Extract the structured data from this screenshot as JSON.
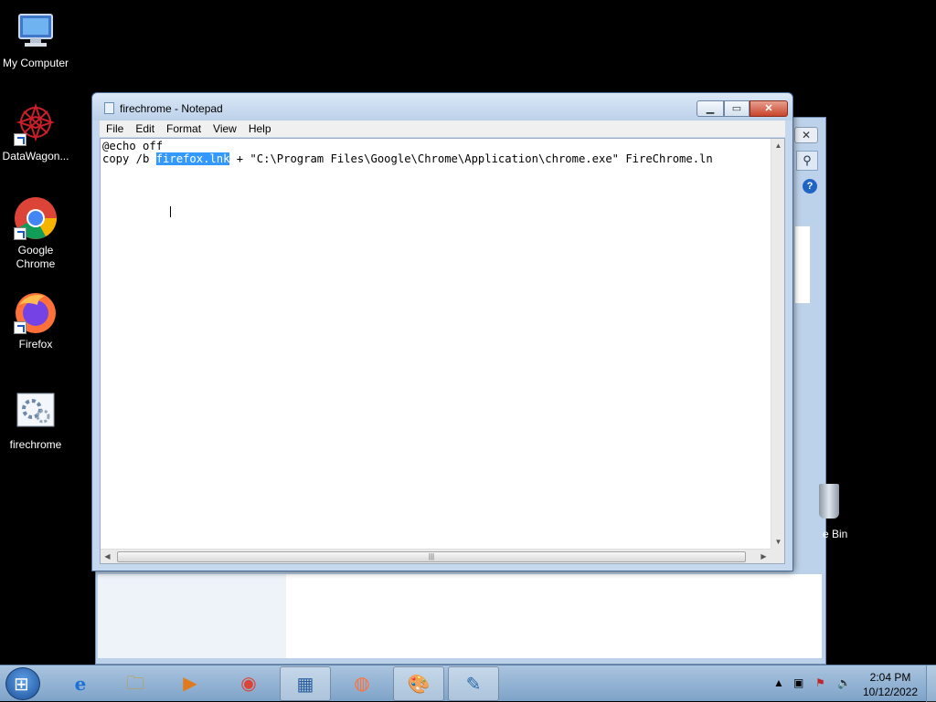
{
  "desktop_icons": [
    {
      "label": "My Computer",
      "icon": "computer-icon"
    },
    {
      "label": "DataWagon...",
      "icon": "datawagon-icon"
    },
    {
      "label": "Google Chrome",
      "icon": "chrome-icon"
    },
    {
      "label": "Firefox",
      "icon": "firefox-icon"
    },
    {
      "label": "firechrome",
      "icon": "batch-file-icon"
    }
  ],
  "background_window": {
    "close_label": "✕",
    "search_label": "⚲",
    "help_label": "?",
    "recycle_label": "e Bin"
  },
  "notepad": {
    "title": "firechrome - Notepad",
    "min_label": "▁",
    "max_label": "▭",
    "close_label": "✕",
    "menu": [
      "File",
      "Edit",
      "Format",
      "View",
      "Help"
    ],
    "lines": {
      "line1": "@echo off",
      "line2_before": "copy /b ",
      "line2_selected": "firefox.lnk",
      "line2_after": " + \"C:\\Program Files\\Google\\Chrome\\Application\\chrome.exe\" FireChrome.ln"
    }
  },
  "taskbar": {
    "buttons": [
      {
        "icon": "ie-icon",
        "glyph": "e"
      },
      {
        "icon": "explorer-icon",
        "glyph": "🗀"
      },
      {
        "icon": "media-player-icon",
        "glyph": "▶"
      },
      {
        "icon": "chrome-icon",
        "glyph": "◉"
      },
      {
        "icon": "control-panel-icon",
        "glyph": "▦"
      },
      {
        "icon": "firefox-icon",
        "glyph": "◍"
      },
      {
        "icon": "paint-icon",
        "glyph": "🎨"
      },
      {
        "icon": "notepad-icon",
        "glyph": "✎"
      }
    ],
    "clock_time": "2:04 PM",
    "clock_date": "10/12/2022",
    "tray_arrow": "▲"
  },
  "colors": {
    "selection": "#3399ff",
    "title_close": "#c8442b"
  }
}
